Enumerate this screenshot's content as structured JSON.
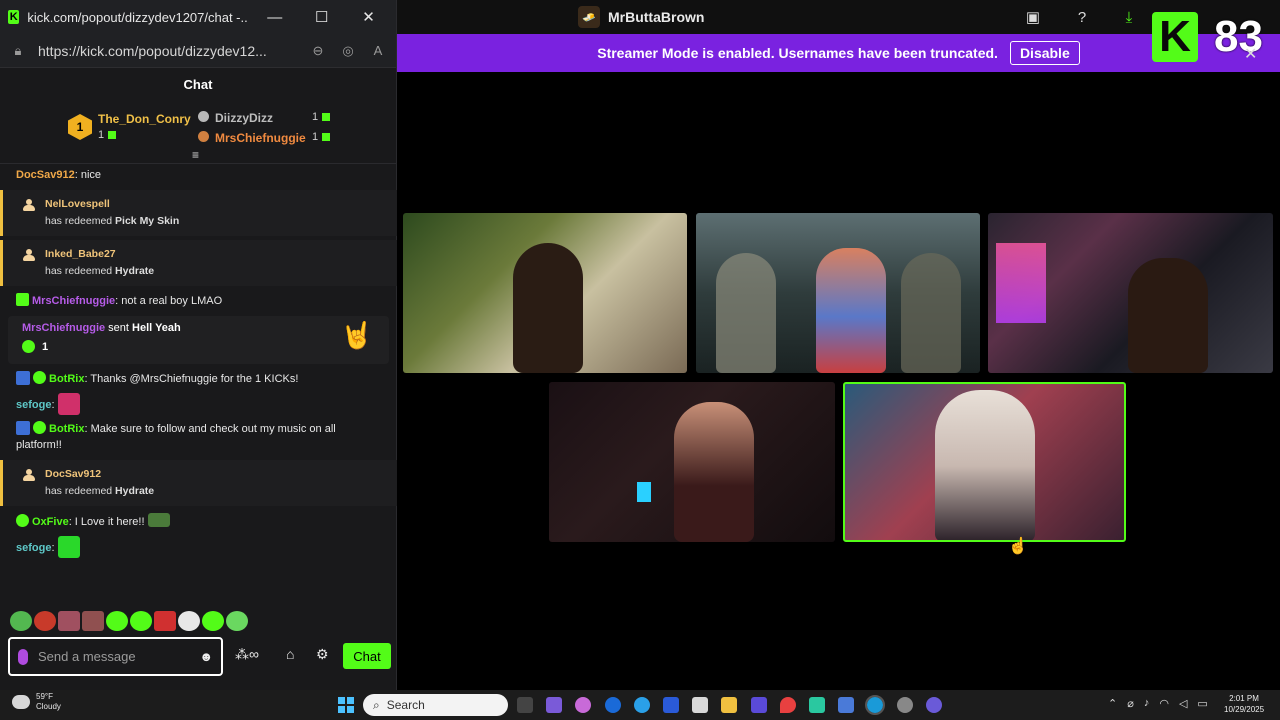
{
  "browser": {
    "window_title": "kick.com/popout/dizzydev1207/chat -...",
    "url": "https://kick.com/popout/dizzydev12...",
    "controls": {
      "minimize": "—",
      "maximize": "☐",
      "close": "✕"
    }
  },
  "chat": {
    "header": "Chat",
    "leaderboard": [
      {
        "rank": "1",
        "name": "The_Don_Conry",
        "count": "1"
      },
      {
        "rank": "2",
        "name": "DiizzyDizz",
        "count": "1"
      },
      {
        "rank": "3",
        "name": "MrsChiefnuggie",
        "count": "1"
      }
    ],
    "messages": [
      {
        "type": "text",
        "user": "DocSav912",
        "user_color": "#f0a848",
        "text": ": nice"
      },
      {
        "type": "redeem",
        "user": "NelLovespell",
        "prefix": "has redeemed ",
        "reward": "Pick My Skin"
      },
      {
        "type": "redeem",
        "user": "Inked_Babe27",
        "prefix": "has redeemed ",
        "reward": "Hydrate"
      },
      {
        "type": "text",
        "user": "MrsChiefnuggie",
        "user_color": "#b65ce8",
        "text": ": not a real boy LMAO",
        "badge": "sub"
      },
      {
        "type": "gift",
        "user": "MrsChiefnuggie",
        "sent": " sent ",
        "item": "Hell Yeah",
        "amount": "1"
      },
      {
        "type": "text",
        "user": "BotRix",
        "user_color": "#53fc18",
        "text": ": Thanks @MrsChiefnuggie for the 1 KICKs!",
        "badge": "bot"
      },
      {
        "type": "emote",
        "user": "sefoge",
        "user_color": "#5ec8c8",
        "text": ":"
      },
      {
        "type": "text",
        "user": "BotRix",
        "user_color": "#53fc18",
        "text": ": Make sure to follow and check out my music on all platform!!",
        "badge": "bot"
      },
      {
        "type": "redeem",
        "user": "DocSav912",
        "prefix": "has redeemed ",
        "reward": "Hydrate"
      },
      {
        "type": "text",
        "user": "OxFive",
        "user_color": "#53fc18",
        "text": ": I Love it here!!",
        "badge": "sub"
      },
      {
        "type": "emote",
        "user": "sefoge",
        "user_color": "#5ec8c8",
        "text": ":"
      }
    ],
    "input_placeholder": "Send a message",
    "chat_button": "Chat"
  },
  "stream": {
    "channel": "MrButtaBrown",
    "banner_text": "Streamer Mode is enabled. Usernames have been truncated.",
    "banner_button": "Disable",
    "viewer_count": "83",
    "k_logo": "K",
    "colors": {
      "brand_green": "#53fc18",
      "banner_purple": "#7a22e0",
      "highlight_border": "#53fc18"
    }
  },
  "taskbar": {
    "weather_temp": "59°F",
    "weather_desc": "Cloudy",
    "search_label": "Search",
    "time": "2:01 PM",
    "date": "10/29/2025"
  }
}
